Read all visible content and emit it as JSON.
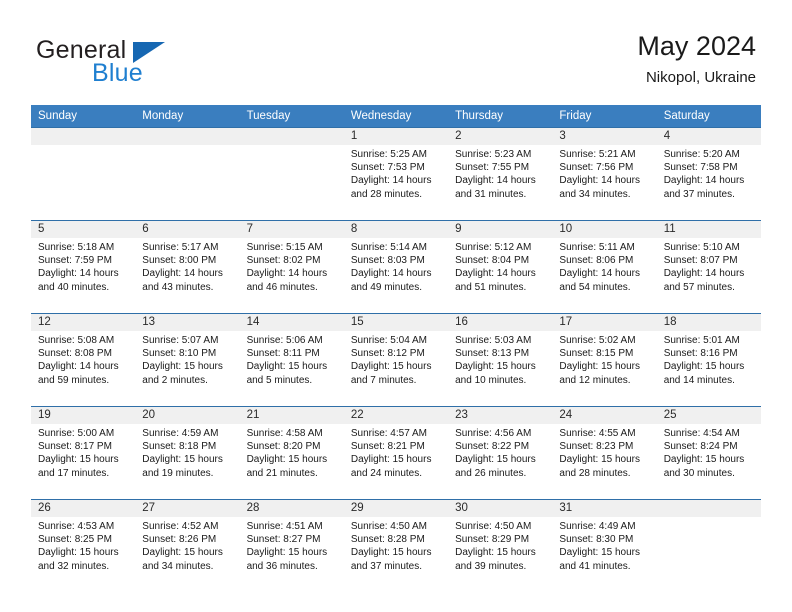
{
  "brand": {
    "name_top": "General",
    "name_bottom": "Blue",
    "triangle_color": "#1667b2",
    "blue_text_color": "#1f7fd0"
  },
  "header": {
    "title": "May 2024",
    "subtitle": "Nikopol, Ukraine"
  },
  "theme": {
    "header_row_bg": "#3a7ebf",
    "header_row_text": "#ffffff",
    "daynum_band_bg": "#f0f0f0",
    "row_border": "#2f6fa8"
  },
  "weekdays": [
    "Sunday",
    "Monday",
    "Tuesday",
    "Wednesday",
    "Thursday",
    "Friday",
    "Saturday"
  ],
  "weeks": [
    [
      {
        "day": "",
        "lines": []
      },
      {
        "day": "",
        "lines": []
      },
      {
        "day": "",
        "lines": []
      },
      {
        "day": "1",
        "lines": [
          "Sunrise: 5:25 AM",
          "Sunset: 7:53 PM",
          "Daylight: 14 hours",
          "and 28 minutes."
        ]
      },
      {
        "day": "2",
        "lines": [
          "Sunrise: 5:23 AM",
          "Sunset: 7:55 PM",
          "Daylight: 14 hours",
          "and 31 minutes."
        ]
      },
      {
        "day": "3",
        "lines": [
          "Sunrise: 5:21 AM",
          "Sunset: 7:56 PM",
          "Daylight: 14 hours",
          "and 34 minutes."
        ]
      },
      {
        "day": "4",
        "lines": [
          "Sunrise: 5:20 AM",
          "Sunset: 7:58 PM",
          "Daylight: 14 hours",
          "and 37 minutes."
        ]
      }
    ],
    [
      {
        "day": "5",
        "lines": [
          "Sunrise: 5:18 AM",
          "Sunset: 7:59 PM",
          "Daylight: 14 hours",
          "and 40 minutes."
        ]
      },
      {
        "day": "6",
        "lines": [
          "Sunrise: 5:17 AM",
          "Sunset: 8:00 PM",
          "Daylight: 14 hours",
          "and 43 minutes."
        ]
      },
      {
        "day": "7",
        "lines": [
          "Sunrise: 5:15 AM",
          "Sunset: 8:02 PM",
          "Daylight: 14 hours",
          "and 46 minutes."
        ]
      },
      {
        "day": "8",
        "lines": [
          "Sunrise: 5:14 AM",
          "Sunset: 8:03 PM",
          "Daylight: 14 hours",
          "and 49 minutes."
        ]
      },
      {
        "day": "9",
        "lines": [
          "Sunrise: 5:12 AM",
          "Sunset: 8:04 PM",
          "Daylight: 14 hours",
          "and 51 minutes."
        ]
      },
      {
        "day": "10",
        "lines": [
          "Sunrise: 5:11 AM",
          "Sunset: 8:06 PM",
          "Daylight: 14 hours",
          "and 54 minutes."
        ]
      },
      {
        "day": "11",
        "lines": [
          "Sunrise: 5:10 AM",
          "Sunset: 8:07 PM",
          "Daylight: 14 hours",
          "and 57 minutes."
        ]
      }
    ],
    [
      {
        "day": "12",
        "lines": [
          "Sunrise: 5:08 AM",
          "Sunset: 8:08 PM",
          "Daylight: 14 hours",
          "and 59 minutes."
        ]
      },
      {
        "day": "13",
        "lines": [
          "Sunrise: 5:07 AM",
          "Sunset: 8:10 PM",
          "Daylight: 15 hours",
          "and 2 minutes."
        ]
      },
      {
        "day": "14",
        "lines": [
          "Sunrise: 5:06 AM",
          "Sunset: 8:11 PM",
          "Daylight: 15 hours",
          "and 5 minutes."
        ]
      },
      {
        "day": "15",
        "lines": [
          "Sunrise: 5:04 AM",
          "Sunset: 8:12 PM",
          "Daylight: 15 hours",
          "and 7 minutes."
        ]
      },
      {
        "day": "16",
        "lines": [
          "Sunrise: 5:03 AM",
          "Sunset: 8:13 PM",
          "Daylight: 15 hours",
          "and 10 minutes."
        ]
      },
      {
        "day": "17",
        "lines": [
          "Sunrise: 5:02 AM",
          "Sunset: 8:15 PM",
          "Daylight: 15 hours",
          "and 12 minutes."
        ]
      },
      {
        "day": "18",
        "lines": [
          "Sunrise: 5:01 AM",
          "Sunset: 8:16 PM",
          "Daylight: 15 hours",
          "and 14 minutes."
        ]
      }
    ],
    [
      {
        "day": "19",
        "lines": [
          "Sunrise: 5:00 AM",
          "Sunset: 8:17 PM",
          "Daylight: 15 hours",
          "and 17 minutes."
        ]
      },
      {
        "day": "20",
        "lines": [
          "Sunrise: 4:59 AM",
          "Sunset: 8:18 PM",
          "Daylight: 15 hours",
          "and 19 minutes."
        ]
      },
      {
        "day": "21",
        "lines": [
          "Sunrise: 4:58 AM",
          "Sunset: 8:20 PM",
          "Daylight: 15 hours",
          "and 21 minutes."
        ]
      },
      {
        "day": "22",
        "lines": [
          "Sunrise: 4:57 AM",
          "Sunset: 8:21 PM",
          "Daylight: 15 hours",
          "and 24 minutes."
        ]
      },
      {
        "day": "23",
        "lines": [
          "Sunrise: 4:56 AM",
          "Sunset: 8:22 PM",
          "Daylight: 15 hours",
          "and 26 minutes."
        ]
      },
      {
        "day": "24",
        "lines": [
          "Sunrise: 4:55 AM",
          "Sunset: 8:23 PM",
          "Daylight: 15 hours",
          "and 28 minutes."
        ]
      },
      {
        "day": "25",
        "lines": [
          "Sunrise: 4:54 AM",
          "Sunset: 8:24 PM",
          "Daylight: 15 hours",
          "and 30 minutes."
        ]
      }
    ],
    [
      {
        "day": "26",
        "lines": [
          "Sunrise: 4:53 AM",
          "Sunset: 8:25 PM",
          "Daylight: 15 hours",
          "and 32 minutes."
        ]
      },
      {
        "day": "27",
        "lines": [
          "Sunrise: 4:52 AM",
          "Sunset: 8:26 PM",
          "Daylight: 15 hours",
          "and 34 minutes."
        ]
      },
      {
        "day": "28",
        "lines": [
          "Sunrise: 4:51 AM",
          "Sunset: 8:27 PM",
          "Daylight: 15 hours",
          "and 36 minutes."
        ]
      },
      {
        "day": "29",
        "lines": [
          "Sunrise: 4:50 AM",
          "Sunset: 8:28 PM",
          "Daylight: 15 hours",
          "and 37 minutes."
        ]
      },
      {
        "day": "30",
        "lines": [
          "Sunrise: 4:50 AM",
          "Sunset: 8:29 PM",
          "Daylight: 15 hours",
          "and 39 minutes."
        ]
      },
      {
        "day": "31",
        "lines": [
          "Sunrise: 4:49 AM",
          "Sunset: 8:30 PM",
          "Daylight: 15 hours",
          "and 41 minutes."
        ]
      },
      {
        "day": "",
        "lines": []
      }
    ]
  ]
}
